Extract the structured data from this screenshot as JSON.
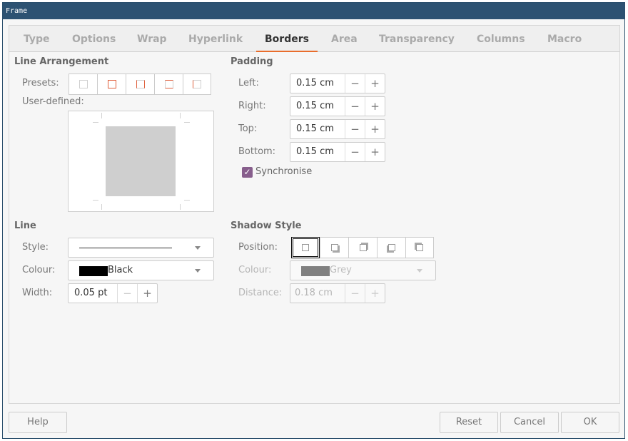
{
  "window": {
    "title": "Frame"
  },
  "tabs": [
    {
      "label": "Type"
    },
    {
      "label": "Options"
    },
    {
      "label": "Wrap"
    },
    {
      "label": "Hyperlink"
    },
    {
      "label": "Borders",
      "active": true
    },
    {
      "label": "Area"
    },
    {
      "label": "Transparency"
    },
    {
      "label": "Columns"
    },
    {
      "label": "Macro"
    }
  ],
  "line_arrangement": {
    "title": "Line Arrangement",
    "presets_label": "Presets:",
    "user_defined_label": "User-defined:"
  },
  "padding": {
    "title": "Padding",
    "left_label": "Left:",
    "left_value": "0.15 cm",
    "right_label": "Right:",
    "right_value": "0.15 cm",
    "top_label": "Top:",
    "top_value": "0.15 cm",
    "bottom_label": "Bottom:",
    "bottom_value": "0.15 cm",
    "synchronise_label": "Synchronise",
    "synchronise_checked": true
  },
  "line": {
    "title": "Line",
    "style_label": "Style:",
    "colour_label": "Colour:",
    "colour_value": "Black",
    "colour_hex": "#000000",
    "width_label": "Width:",
    "width_value": "0.05 pt"
  },
  "shadow_style": {
    "title": "Shadow Style",
    "position_label": "Position:",
    "colour_label": "Colour:",
    "colour_value": "Grey",
    "colour_hex": "#808080",
    "distance_label": "Distance:",
    "distance_value": "0.18 cm"
  },
  "footer": {
    "help": "Help",
    "reset": "Reset",
    "cancel": "Cancel",
    "ok": "OK"
  },
  "colors": {
    "titlebar": "#2d5272",
    "tab_accent": "#e96d2c",
    "checkbox": "#875e8c"
  }
}
